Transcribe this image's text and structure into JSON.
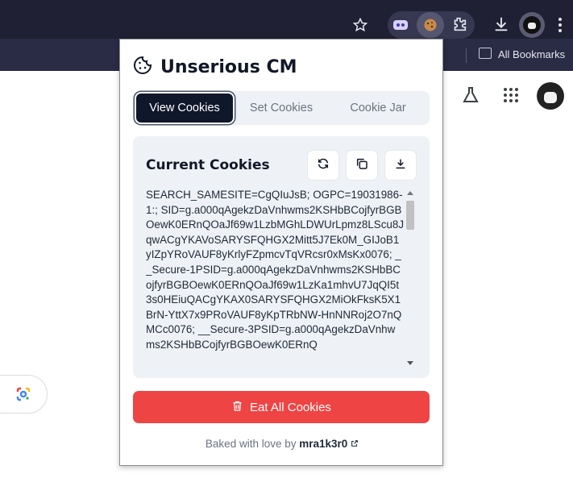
{
  "browser": {
    "bookmarks_label": "All Bookmarks"
  },
  "popup": {
    "title": "Unserious CM",
    "tabs": [
      {
        "label": "View Cookies",
        "active": true
      },
      {
        "label": "Set Cookies",
        "active": false
      },
      {
        "label": "Cookie Jar",
        "active": false
      }
    ],
    "card_title": "Current Cookies",
    "cookie_text": "SEARCH_SAMESITE=CgQIuJsB; OGPC=19031986-1:; SID=g.a000qAgekzDaVnhwms2KSHbBCojfyrBGBOewK0ERnQOaJf69w1LzbMGhLDWUrLpmz8LScu8JqwACgYKAVoSARYSFQHGX2Mitt5J7Ek0M_GIJoB1yIZpYRoVAUF8yKrlyFZpmcvTqVRcsr0xMsKx0076; __Secure-1PSID=g.a000qAgekzDaVnhwms2KSHbBCojfyrBGBOewK0ERnQOaJf69w1LzKa1mhvU7JqQI5t3s0HEiuQACgYKAX0SARYSFQHGX2MiOkFksK5X1BrN-YttX7x9PRoVAUF8yKpTRbNW-HnNNRoj2O7nQMCc0076; __Secure-3PSID=g.a000qAgekzDaVnhwms2KSHbBCojfyrBGBOewK0ERnQ",
    "eat_button_label": "Eat All Cookies",
    "footer_prefix": "Baked with love by",
    "footer_author": "mra1k3r0",
    "colors": {
      "accent_dark": "#0f172a",
      "danger": "#ef4444",
      "panel": "#eef2f6"
    }
  }
}
